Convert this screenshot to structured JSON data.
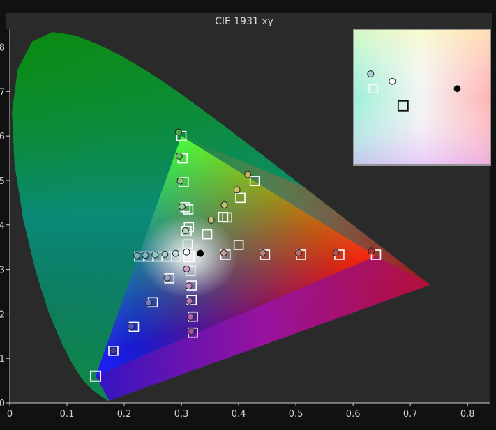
{
  "chart_data": {
    "type": "scatter",
    "title": "CIE 1931 xy",
    "xlim": [
      0,
      0.84
    ],
    "ylim": [
      0,
      0.84
    ],
    "x_ticks": [
      {
        "value": 0,
        "label": "0"
      },
      {
        "value": 0.1,
        "label": "0.1"
      },
      {
        "value": 0.2,
        "label": "0.2"
      },
      {
        "value": 0.3,
        "label": "0.3"
      },
      {
        "value": 0.4,
        "label": "0.4"
      },
      {
        "value": 0.5,
        "label": "0.5"
      },
      {
        "value": 0.6,
        "label": "0.6"
      },
      {
        "value": 0.7,
        "label": "0.7"
      },
      {
        "value": 0.8,
        "label": "0.8"
      }
    ],
    "y_ticks": [
      {
        "value": 0,
        "label": "0"
      },
      {
        "value": 0.1,
        "label": "1"
      },
      {
        "value": 0.2,
        "label": "2"
      },
      {
        "value": 0.3,
        "label": "3"
      },
      {
        "value": 0.4,
        "label": "4"
      },
      {
        "value": 0.5,
        "label": "5"
      },
      {
        "value": 0.6,
        "label": "6"
      },
      {
        "value": 0.7,
        "label": "7"
      },
      {
        "value": 0.8,
        "label": "8"
      }
    ],
    "grid": false,
    "spectral_locus": [
      [
        0.1741,
        0.005
      ],
      [
        0.1738,
        0.0049
      ],
      [
        0.1736,
        0.0049
      ],
      [
        0.1733,
        0.0048
      ],
      [
        0.173,
        0.0048
      ],
      [
        0.1726,
        0.0048
      ],
      [
        0.1721,
        0.0048
      ],
      [
        0.1714,
        0.0051
      ],
      [
        0.1703,
        0.0058
      ],
      [
        0.1689,
        0.0069
      ],
      [
        0.1669,
        0.0086
      ],
      [
        0.1644,
        0.0109
      ],
      [
        0.1611,
        0.0138
      ],
      [
        0.1566,
        0.0177
      ],
      [
        0.151,
        0.0227
      ],
      [
        0.144,
        0.0297
      ],
      [
        0.1355,
        0.0399
      ],
      [
        0.1241,
        0.0578
      ],
      [
        0.1096,
        0.0868
      ],
      [
        0.0913,
        0.1327
      ],
      [
        0.0687,
        0.2007
      ],
      [
        0.0454,
        0.295
      ],
      [
        0.0235,
        0.4127
      ],
      [
        0.0082,
        0.5384
      ],
      [
        0.0039,
        0.6548
      ],
      [
        0.0139,
        0.7502
      ],
      [
        0.0389,
        0.812
      ],
      [
        0.0743,
        0.8338
      ],
      [
        0.1142,
        0.8262
      ],
      [
        0.1547,
        0.8059
      ],
      [
        0.1929,
        0.7816
      ],
      [
        0.2296,
        0.7543
      ],
      [
        0.2658,
        0.7243
      ],
      [
        0.3016,
        0.6923
      ],
      [
        0.3373,
        0.6589
      ],
      [
        0.3731,
        0.6245
      ],
      [
        0.4087,
        0.5896
      ],
      [
        0.4441,
        0.5547
      ],
      [
        0.4788,
        0.5202
      ],
      [
        0.5125,
        0.4866
      ],
      [
        0.5448,
        0.4544
      ],
      [
        0.5752,
        0.4242
      ],
      [
        0.6029,
        0.3965
      ],
      [
        0.627,
        0.3725
      ],
      [
        0.6482,
        0.3514
      ],
      [
        0.6658,
        0.334
      ],
      [
        0.6801,
        0.3197
      ],
      [
        0.6915,
        0.3083
      ],
      [
        0.7006,
        0.2993
      ],
      [
        0.7079,
        0.292
      ],
      [
        0.714,
        0.2859
      ],
      [
        0.719,
        0.2809
      ],
      [
        0.723,
        0.277
      ],
      [
        0.726,
        0.274
      ],
      [
        0.7283,
        0.2717
      ],
      [
        0.73,
        0.27
      ],
      [
        0.7311,
        0.2689
      ],
      [
        0.732,
        0.268
      ],
      [
        0.7327,
        0.2673
      ],
      [
        0.7334,
        0.2666
      ],
      [
        0.734,
        0.266
      ],
      [
        0.7344,
        0.2656
      ],
      [
        0.7347,
        0.2653
      ]
    ],
    "gamut_triangle": [
      [
        0.64,
        0.33
      ],
      [
        0.3,
        0.6
      ],
      [
        0.15,
        0.06
      ]
    ],
    "target_points": [
      [
        0.15,
        0.06
      ],
      [
        0.181,
        0.117
      ],
      [
        0.217,
        0.171
      ],
      [
        0.25,
        0.226
      ],
      [
        0.279,
        0.28
      ],
      [
        0.313,
        0.329
      ],
      [
        0.4,
        0.355
      ],
      [
        0.3,
        0.6
      ],
      [
        0.302,
        0.55
      ],
      [
        0.304,
        0.496
      ],
      [
        0.307,
        0.44
      ],
      [
        0.309,
        0.386
      ],
      [
        0.311,
        0.356
      ],
      [
        0.313,
        0.395
      ],
      [
        0.312,
        0.435
      ],
      [
        0.345,
        0.379
      ],
      [
        0.373,
        0.418
      ],
      [
        0.403,
        0.461
      ],
      [
        0.428,
        0.499
      ],
      [
        0.38,
        0.417
      ],
      [
        0.226,
        0.329
      ],
      [
        0.243,
        0.329
      ],
      [
        0.258,
        0.329
      ],
      [
        0.275,
        0.329
      ],
      [
        0.291,
        0.329
      ],
      [
        0.316,
        0.297
      ],
      [
        0.318,
        0.264
      ],
      [
        0.318,
        0.231
      ],
      [
        0.32,
        0.194
      ],
      [
        0.32,
        0.158
      ],
      [
        0.377,
        0.333
      ],
      [
        0.446,
        0.333
      ],
      [
        0.509,
        0.333
      ],
      [
        0.576,
        0.333
      ],
      [
        0.64,
        0.333
      ]
    ],
    "measured_points": [
      {
        "x": 0.181,
        "y": 0.117,
        "color": "#4a3f9e"
      },
      {
        "x": 0.212,
        "y": 0.172,
        "color": "#5555c0"
      },
      {
        "x": 0.243,
        "y": 0.225,
        "color": "#7777c8"
      },
      {
        "x": 0.275,
        "y": 0.281,
        "color": "#9f9fd0"
      },
      {
        "x": 0.295,
        "y": 0.609,
        "color": "#4aa84a"
      },
      {
        "x": 0.296,
        "y": 0.555,
        "color": "#66bb66"
      },
      {
        "x": 0.298,
        "y": 0.499,
        "color": "#86c686"
      },
      {
        "x": 0.301,
        "y": 0.441,
        "color": "#99cc99"
      },
      {
        "x": 0.307,
        "y": 0.387,
        "color": "#b5d6b5"
      },
      {
        "x": 0.352,
        "y": 0.411,
        "color": "#c4c07a"
      },
      {
        "x": 0.375,
        "y": 0.445,
        "color": "#c0c070"
      },
      {
        "x": 0.397,
        "y": 0.479,
        "color": "#c8c060"
      },
      {
        "x": 0.416,
        "y": 0.513,
        "color": "#c4b454"
      },
      {
        "x": 0.222,
        "y": 0.331,
        "color": "#66b4b4"
      },
      {
        "x": 0.237,
        "y": 0.332,
        "color": "#7cbebe"
      },
      {
        "x": 0.254,
        "y": 0.333,
        "color": "#92c8c8"
      },
      {
        "x": 0.271,
        "y": 0.334,
        "color": "#a8d2d2"
      },
      {
        "x": 0.29,
        "y": 0.336,
        "color": "#c0dcdc"
      },
      {
        "x": 0.309,
        "y": 0.339,
        "color": "#ffffff"
      },
      {
        "x": 0.333,
        "y": 0.336,
        "color": "#000000"
      },
      {
        "x": 0.309,
        "y": 0.301,
        "color": "#c8a0c8"
      },
      {
        "x": 0.313,
        "y": 0.263,
        "color": "#c48cc4"
      },
      {
        "x": 0.314,
        "y": 0.229,
        "color": "#b878b8"
      },
      {
        "x": 0.316,
        "y": 0.193,
        "color": "#b064b0"
      },
      {
        "x": 0.317,
        "y": 0.161,
        "color": "#a050a0"
      },
      {
        "x": 0.374,
        "y": 0.337,
        "color": "#c49c9c"
      },
      {
        "x": 0.442,
        "y": 0.337,
        "color": "#c08080"
      },
      {
        "x": 0.505,
        "y": 0.337,
        "color": "#c06a6a"
      },
      {
        "x": 0.57,
        "y": 0.337,
        "color": "#b85050"
      },
      {
        "x": 0.632,
        "y": 0.341,
        "color": "#b03030"
      }
    ]
  },
  "inset": {
    "points": [
      {
        "x": 0.301,
        "y": 0.342,
        "color": "#a8d0d0"
      },
      {
        "x": 0.309,
        "y": 0.339,
        "color": "#ffffff"
      },
      {
        "x": 0.333,
        "y": 0.336,
        "color": "#000000"
      }
    ],
    "targets": [
      [
        0.302,
        0.336
      ],
      [
        0.313,
        0.329
      ]
    ]
  }
}
